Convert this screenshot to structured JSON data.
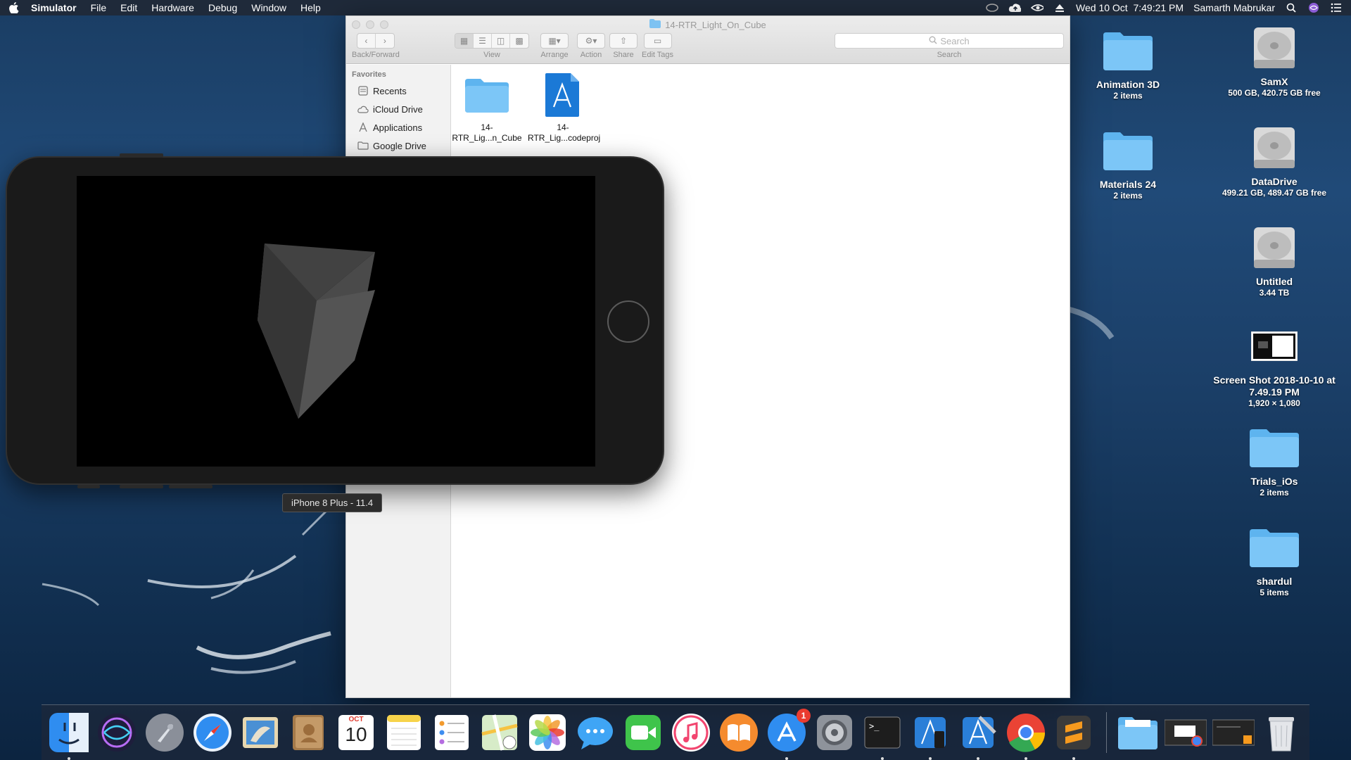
{
  "menubar": {
    "apple_icon": "apple-icon",
    "app_name": "Simulator",
    "menus": [
      "File",
      "Edit",
      "Hardware",
      "Debug",
      "Window",
      "Help"
    ],
    "status_icons": [
      "creative-cloud-icon",
      "cloud-upload-icon",
      "nvidia-icon",
      "eject-icon"
    ],
    "clock": "Wed 10 Oct  7:49:21 PM",
    "user": "Samarth Mabrukar"
  },
  "finder": {
    "title": "14-RTR_Light_On_Cube",
    "toolbar": {
      "back_forward_label": "Back/Forward",
      "view_label": "View",
      "arrange_label": "Arrange",
      "action_label": "Action",
      "share_label": "Share",
      "edit_tags_label": "Edit Tags",
      "search_placeholder": "Search",
      "search_label": "Search"
    },
    "sidebar": {
      "heading": "Favorites",
      "items": [
        {
          "label": "Recents",
          "icon": "recents-icon"
        },
        {
          "label": "iCloud Drive",
          "icon": "cloud-icon"
        },
        {
          "label": "Applications",
          "icon": "applications-icon"
        },
        {
          "label": "Google Drive",
          "icon": "folder-icon"
        }
      ]
    },
    "files": [
      {
        "line1": "14-",
        "line2": "RTR_Lig...n_Cube",
        "icon": "folder-icon"
      },
      {
        "line1": "14-",
        "line2": "RTR_Lig...codeproj",
        "icon": "xcodeproj-icon"
      }
    ]
  },
  "simulator": {
    "tooltip": "iPhone 8 Plus - 11.4"
  },
  "desktop_icons": [
    {
      "name": "Animation 3D",
      "info": "2 items",
      "icon": "folder-icon"
    },
    {
      "name": "SamX",
      "info": "500 GB, 420.75 GB free",
      "icon": "hard-drive-icon"
    },
    {
      "name": "Materials 24",
      "info": "2 items",
      "icon": "folder-icon"
    },
    {
      "name": "DataDrive",
      "info": "499.21 GB, 489.47 GB free",
      "icon": "hard-drive-icon"
    },
    {
      "name": "Untitled",
      "info": "3.44 TB",
      "icon": "hard-drive-icon"
    },
    {
      "name": "Screen Shot 2018-10-10 at 7.49.19 PM",
      "info": "1,920 × 1,080",
      "icon": "screenshot-thumbnail-icon"
    },
    {
      "name": "Trials_iOs",
      "info": "2 items",
      "icon": "folder-icon"
    },
    {
      "name": "shardul",
      "info": "5 items",
      "icon": "folder-icon"
    }
  ],
  "dock": {
    "calendar_month": "OCT",
    "calendar_day": "10",
    "app_store_badge": "1",
    "items": [
      "finder-icon",
      "siri-icon",
      "launchpad-icon",
      "safari-icon",
      "mail-icon",
      "contacts-icon",
      "calendar-icon",
      "notes-icon",
      "reminders-icon",
      "maps-icon",
      "photos-icon",
      "messages-icon",
      "facetime-icon",
      "itunes-icon",
      "ibooks-icon",
      "app-store-icon",
      "system-preferences-icon",
      "terminal-icon",
      "xcode-instruments-icon",
      "xcode-icon",
      "chrome-icon",
      "sublime-text-icon",
      "downloads-folder-icon",
      "chrome-window-icon",
      "sublime-window-icon",
      "trash-icon"
    ]
  }
}
